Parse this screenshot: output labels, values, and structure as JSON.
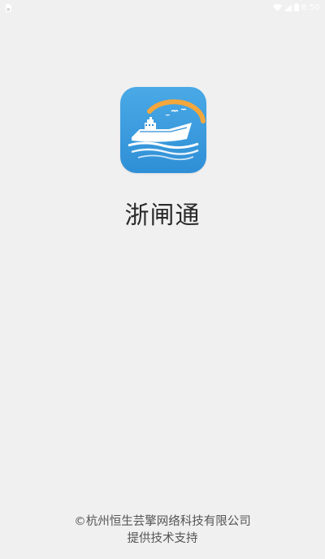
{
  "status_bar": {
    "time": "8:50",
    "left_icon": "sim-card-icon",
    "icons": [
      "wifi-icon",
      "signal-icon",
      "battery-icon"
    ]
  },
  "app": {
    "icon": "ship-icon",
    "name": "浙闸通"
  },
  "footer": {
    "copyright": "©杭州恒生芸擎网络科技有限公司",
    "support": "提供技术支持"
  },
  "colors": {
    "background": "#f0f0f0",
    "icon_blue": "#3d9fe0",
    "sun_arc": "#f0a23a"
  }
}
